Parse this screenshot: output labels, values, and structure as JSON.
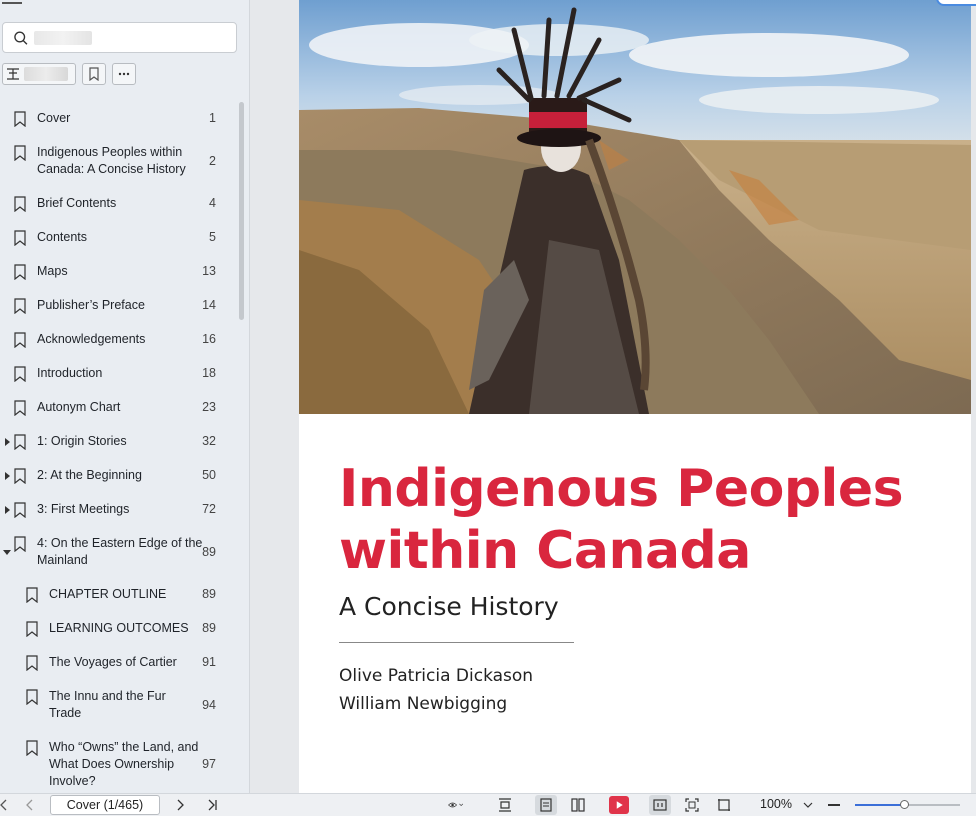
{
  "sidebar": {
    "search": {
      "value": "",
      "placeholder": ""
    },
    "toc": [
      {
        "label": "Cover",
        "page": "1",
        "level": 0,
        "expand": "none"
      },
      {
        "label": "Indigenous Peoples within Canada: A Concise History",
        "page": "2",
        "level": 0,
        "expand": "none"
      },
      {
        "label": "Brief Contents",
        "page": "4",
        "level": 0,
        "expand": "none"
      },
      {
        "label": "Contents",
        "page": "5",
        "level": 0,
        "expand": "none"
      },
      {
        "label": "Maps",
        "page": "13",
        "level": 0,
        "expand": "none"
      },
      {
        "label": "Publisher’s Preface",
        "page": "14",
        "level": 0,
        "expand": "none"
      },
      {
        "label": "Acknowledgements",
        "page": "16",
        "level": 0,
        "expand": "none"
      },
      {
        "label": "Introduction",
        "page": "18",
        "level": 0,
        "expand": "none"
      },
      {
        "label": "Autonym Chart",
        "page": "23",
        "level": 0,
        "expand": "none"
      },
      {
        "label": "1: Origin Stories",
        "page": "32",
        "level": 0,
        "expand": "collapsed"
      },
      {
        "label": "2: At the Beginning",
        "page": "50",
        "level": 0,
        "expand": "collapsed"
      },
      {
        "label": "3: First Meetings",
        "page": "72",
        "level": 0,
        "expand": "collapsed"
      },
      {
        "label": "4: On the Eastern Edge of the Mainland",
        "page": "89",
        "level": 0,
        "expand": "expanded"
      },
      {
        "label": "CHAPTER OUTLINE",
        "page": "89",
        "level": 1,
        "expand": "none"
      },
      {
        "label": "LEARNING OUTCOMES",
        "page": "89",
        "level": 1,
        "expand": "none"
      },
      {
        "label": "The Voyages of Cartier",
        "page": "91",
        "level": 1,
        "expand": "none"
      },
      {
        "label": "The Innu and the Fur Trade",
        "page": "94",
        "level": 1,
        "expand": "none"
      },
      {
        "label": "Who “Owns” the Land, and What Does Ownership Involve?",
        "page": "97",
        "level": 1,
        "expand": "none"
      }
    ]
  },
  "document": {
    "title": "Indigenous Peoples within Canada",
    "subtitle": "A Concise History",
    "authors": [
      "Olive Patricia Dickason",
      "William Newbigging"
    ],
    "title_color": "#d9263e"
  },
  "bottom_bar": {
    "page_indicator": "Cover (1/465)",
    "zoom": "100%",
    "zoom_level": 0.48,
    "play_color": "#e0344a"
  }
}
